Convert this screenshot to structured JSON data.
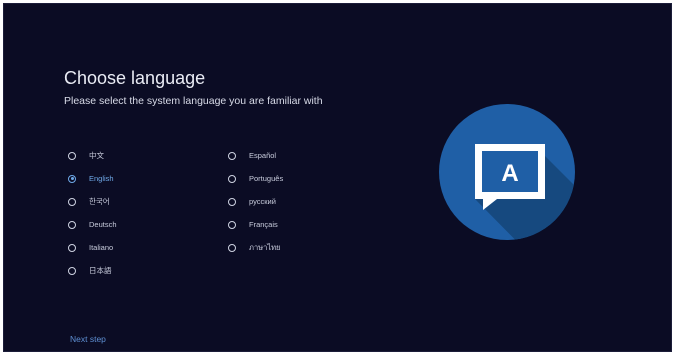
{
  "header": {
    "title": "Choose language",
    "subtitle": "Please select the system language you are familiar with"
  },
  "languages": {
    "left": [
      {
        "label": "中文",
        "selected": false
      },
      {
        "label": "English",
        "selected": true
      },
      {
        "label": "한국어",
        "selected": false
      },
      {
        "label": "Deutsch",
        "selected": false
      },
      {
        "label": "Italiano",
        "selected": false
      },
      {
        "label": "日本語",
        "selected": false
      }
    ],
    "right": [
      {
        "label": "Español",
        "selected": false
      },
      {
        "label": "Português",
        "selected": false
      },
      {
        "label": "русский",
        "selected": false
      },
      {
        "label": "Français",
        "selected": false
      },
      {
        "label": "ภาษาไทย",
        "selected": false
      }
    ]
  },
  "footer": {
    "next_label": "Next step"
  },
  "illustration": {
    "icon": "language-A-speech-bubble-icon",
    "glyph": "A"
  },
  "colors": {
    "background": "#0b0c24",
    "accent": "#6fa9e8",
    "circle": "#1f5fa6",
    "bubble": "#ffffff"
  }
}
